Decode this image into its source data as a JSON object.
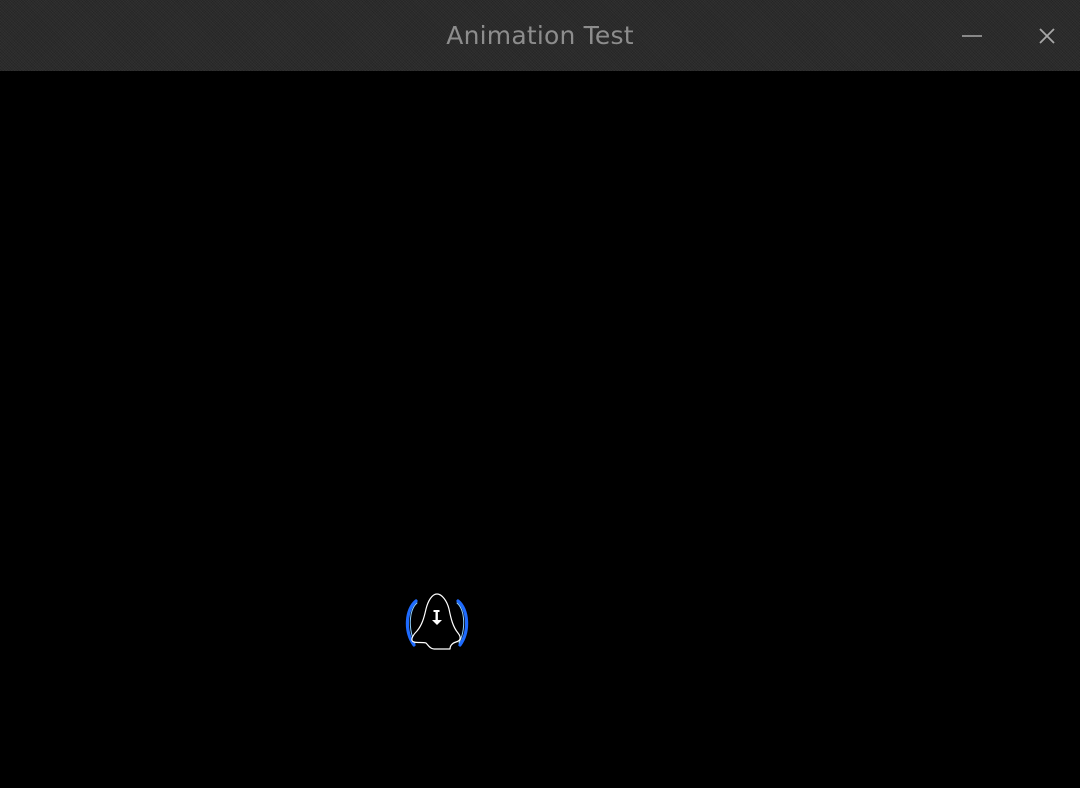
{
  "window": {
    "title": "Animation Test",
    "background_color": "#000000",
    "titlebar_color": "#2a2a2a",
    "title_color": "#8d8d8d"
  },
  "controls": {
    "minimize_icon": "minimize-icon",
    "close_icon": "close-icon"
  },
  "sprite": {
    "icon": "ghost-sprite-icon",
    "outline_color": "#ffffff",
    "shield_color": "#1e6bff",
    "shield_highlight_color": "#8fd0ff"
  }
}
